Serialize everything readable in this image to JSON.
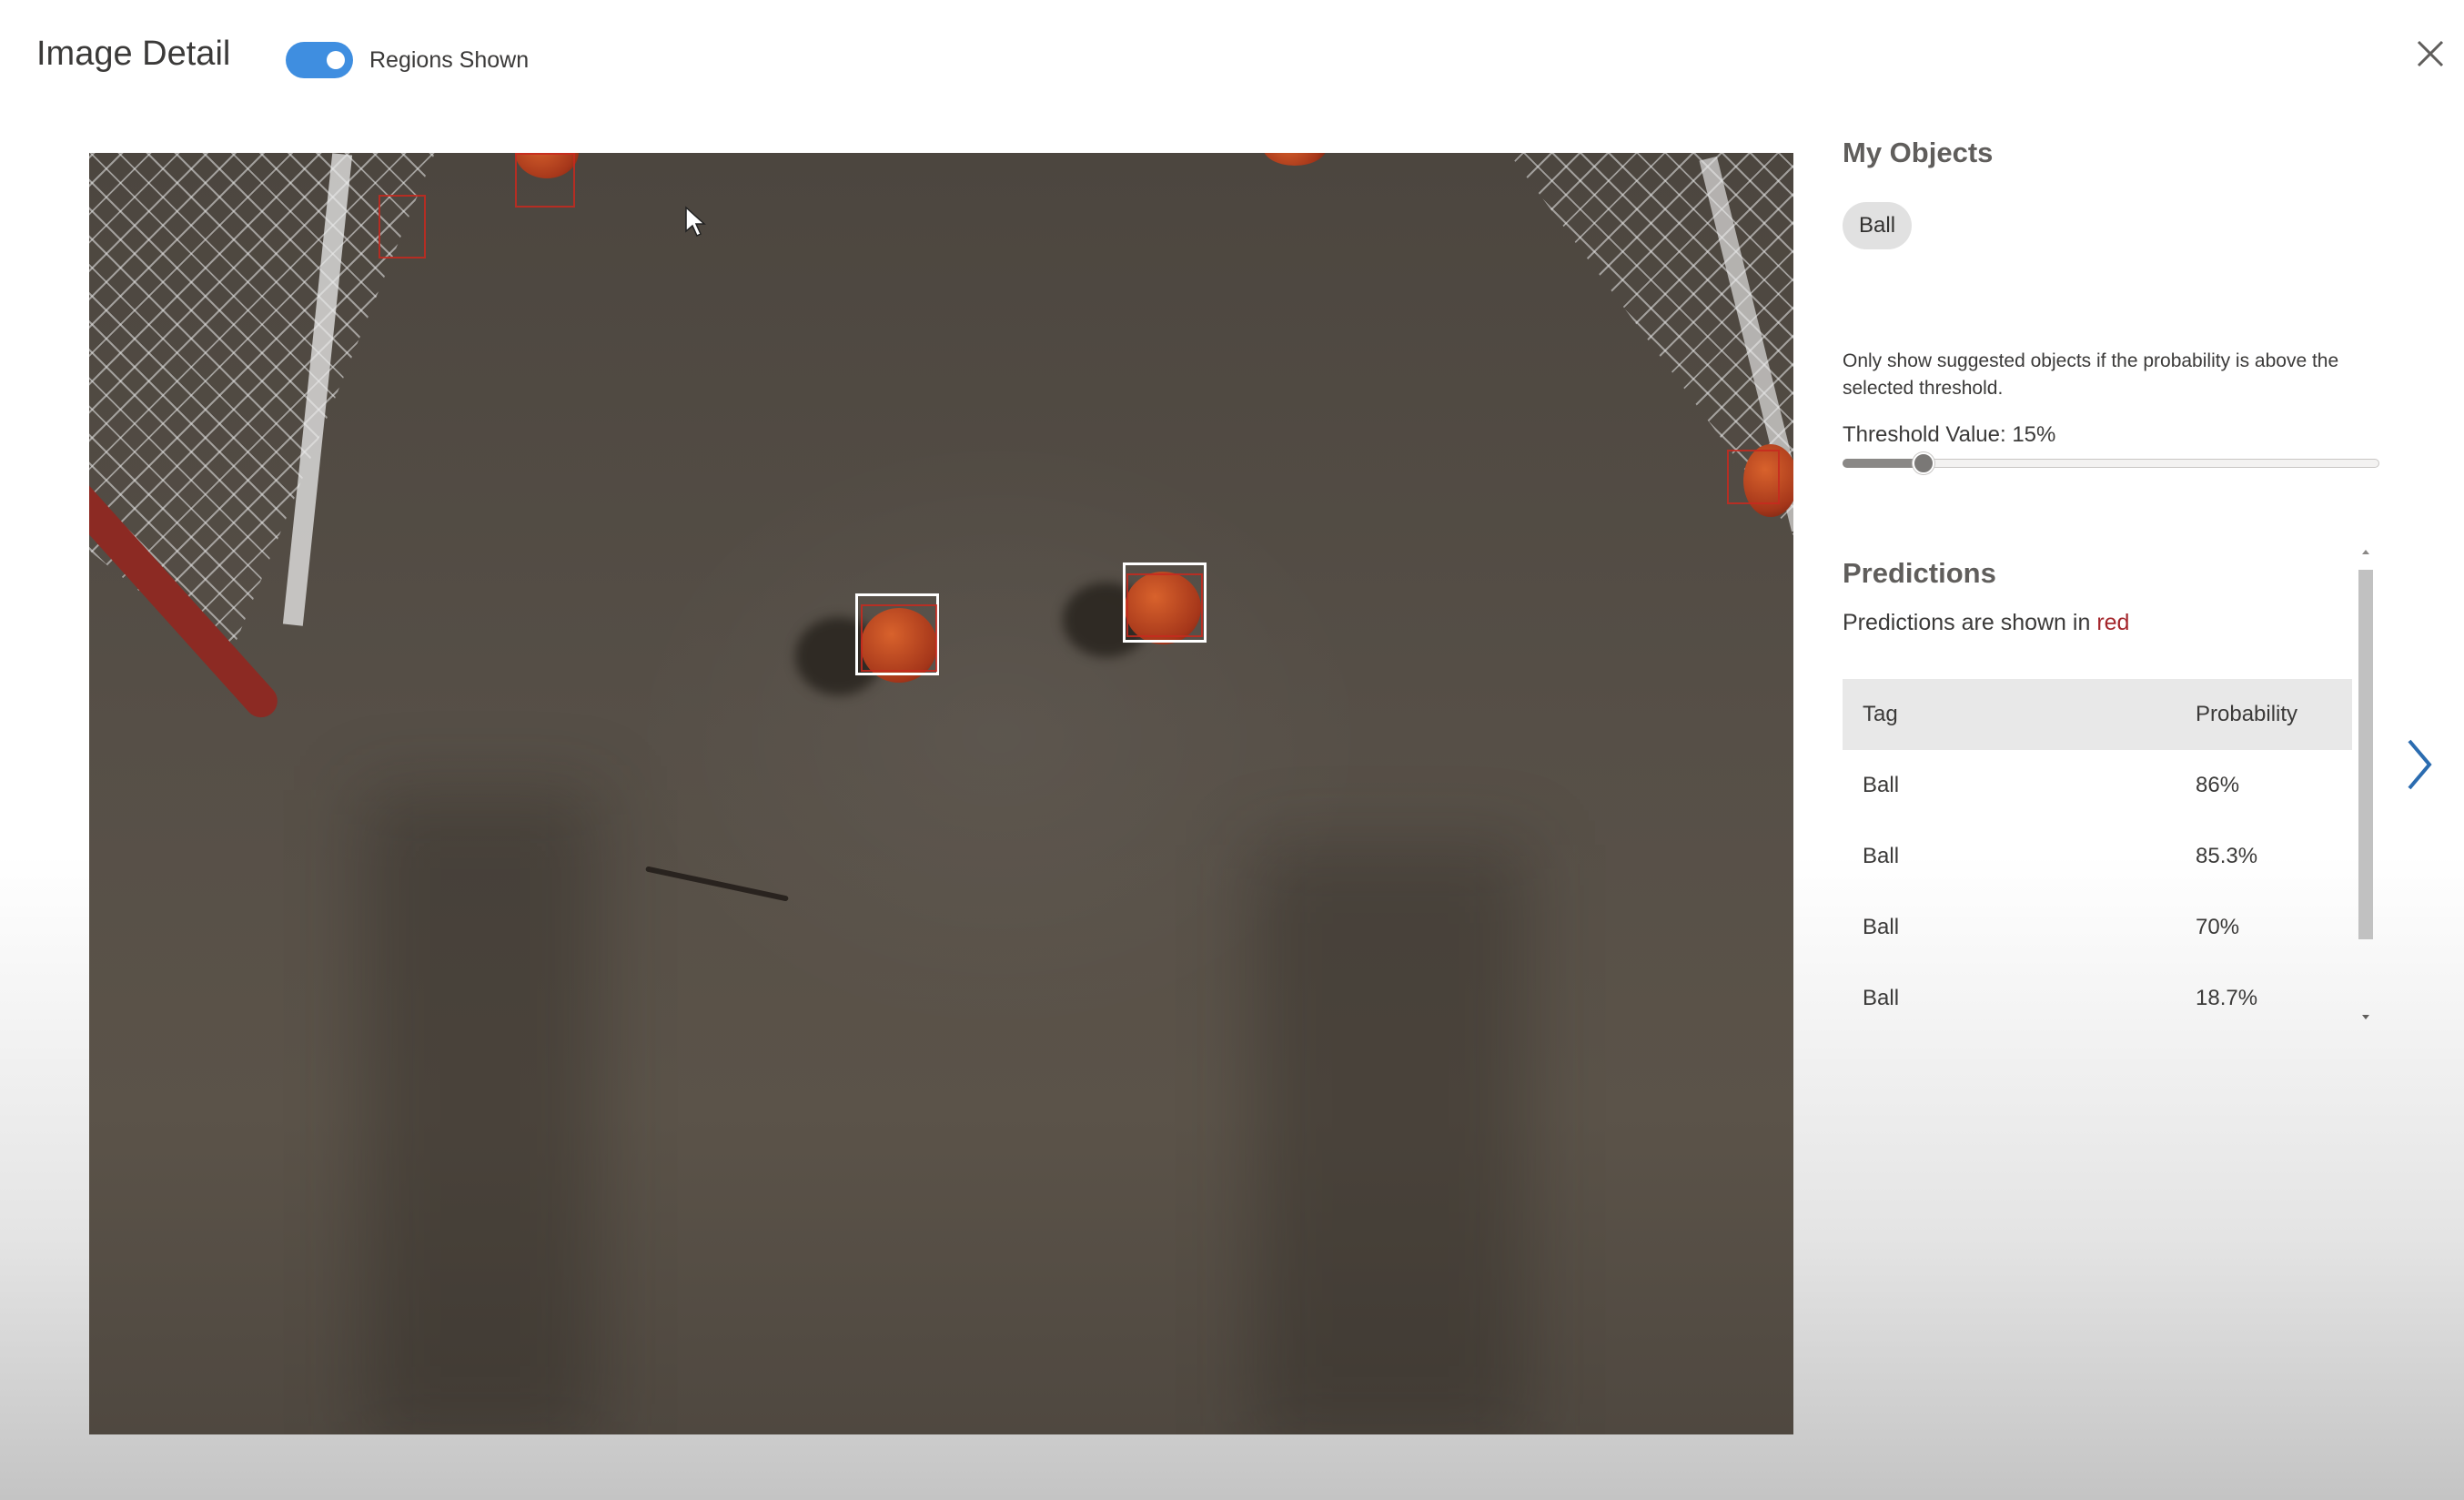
{
  "header": {
    "title": "Image Detail",
    "regions_toggle": {
      "label": "Regions Shown",
      "on": true
    }
  },
  "icons": {
    "close": "close-icon",
    "next": "chevron-right-icon",
    "cursor": "mouse-pointer-icon"
  },
  "my_objects": {
    "heading": "My Objects",
    "tags": [
      "Ball"
    ]
  },
  "threshold": {
    "description": "Only show suggested objects if the probability is above the selected threshold.",
    "label": "Threshold Value: 15%",
    "value_percent": 15
  },
  "predictions": {
    "heading": "Predictions",
    "subtitle_prefix": "Predictions are shown in ",
    "subtitle_highlight": "red",
    "columns": [
      "Tag",
      "Probability"
    ],
    "rows": [
      {
        "tag": "Ball",
        "probability": "86%"
      },
      {
        "tag": "Ball",
        "probability": "85.3%"
      },
      {
        "tag": "Ball",
        "probability": "70%"
      },
      {
        "tag": "Ball",
        "probability": "18.7%"
      }
    ]
  },
  "colors": {
    "toggle_on": "#3f8ee0",
    "prediction_box": "#c8291f",
    "tagged_region_box": "#ffffff",
    "next_arrow": "#2b6cb0"
  }
}
